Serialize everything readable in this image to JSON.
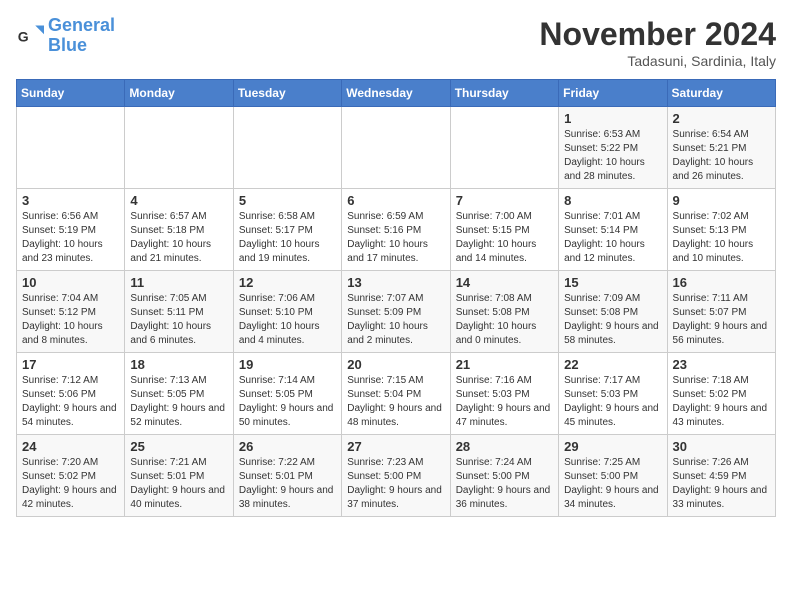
{
  "logo": {
    "line1": "General",
    "line2": "Blue"
  },
  "title": "November 2024",
  "location": "Tadasuni, Sardinia, Italy",
  "weekdays": [
    "Sunday",
    "Monday",
    "Tuesday",
    "Wednesday",
    "Thursday",
    "Friday",
    "Saturday"
  ],
  "weeks": [
    [
      {
        "day": "",
        "info": ""
      },
      {
        "day": "",
        "info": ""
      },
      {
        "day": "",
        "info": ""
      },
      {
        "day": "",
        "info": ""
      },
      {
        "day": "",
        "info": ""
      },
      {
        "day": "1",
        "info": "Sunrise: 6:53 AM\nSunset: 5:22 PM\nDaylight: 10 hours\nand 28 minutes."
      },
      {
        "day": "2",
        "info": "Sunrise: 6:54 AM\nSunset: 5:21 PM\nDaylight: 10 hours\nand 26 minutes."
      }
    ],
    [
      {
        "day": "3",
        "info": "Sunrise: 6:56 AM\nSunset: 5:19 PM\nDaylight: 10 hours\nand 23 minutes."
      },
      {
        "day": "4",
        "info": "Sunrise: 6:57 AM\nSunset: 5:18 PM\nDaylight: 10 hours\nand 21 minutes."
      },
      {
        "day": "5",
        "info": "Sunrise: 6:58 AM\nSunset: 5:17 PM\nDaylight: 10 hours\nand 19 minutes."
      },
      {
        "day": "6",
        "info": "Sunrise: 6:59 AM\nSunset: 5:16 PM\nDaylight: 10 hours\nand 17 minutes."
      },
      {
        "day": "7",
        "info": "Sunrise: 7:00 AM\nSunset: 5:15 PM\nDaylight: 10 hours\nand 14 minutes."
      },
      {
        "day": "8",
        "info": "Sunrise: 7:01 AM\nSunset: 5:14 PM\nDaylight: 10 hours\nand 12 minutes."
      },
      {
        "day": "9",
        "info": "Sunrise: 7:02 AM\nSunset: 5:13 PM\nDaylight: 10 hours\nand 10 minutes."
      }
    ],
    [
      {
        "day": "10",
        "info": "Sunrise: 7:04 AM\nSunset: 5:12 PM\nDaylight: 10 hours\nand 8 minutes."
      },
      {
        "day": "11",
        "info": "Sunrise: 7:05 AM\nSunset: 5:11 PM\nDaylight: 10 hours\nand 6 minutes."
      },
      {
        "day": "12",
        "info": "Sunrise: 7:06 AM\nSunset: 5:10 PM\nDaylight: 10 hours\nand 4 minutes."
      },
      {
        "day": "13",
        "info": "Sunrise: 7:07 AM\nSunset: 5:09 PM\nDaylight: 10 hours\nand 2 minutes."
      },
      {
        "day": "14",
        "info": "Sunrise: 7:08 AM\nSunset: 5:08 PM\nDaylight: 10 hours\nand 0 minutes."
      },
      {
        "day": "15",
        "info": "Sunrise: 7:09 AM\nSunset: 5:08 PM\nDaylight: 9 hours\nand 58 minutes."
      },
      {
        "day": "16",
        "info": "Sunrise: 7:11 AM\nSunset: 5:07 PM\nDaylight: 9 hours\nand 56 minutes."
      }
    ],
    [
      {
        "day": "17",
        "info": "Sunrise: 7:12 AM\nSunset: 5:06 PM\nDaylight: 9 hours\nand 54 minutes."
      },
      {
        "day": "18",
        "info": "Sunrise: 7:13 AM\nSunset: 5:05 PM\nDaylight: 9 hours\nand 52 minutes."
      },
      {
        "day": "19",
        "info": "Sunrise: 7:14 AM\nSunset: 5:05 PM\nDaylight: 9 hours\nand 50 minutes."
      },
      {
        "day": "20",
        "info": "Sunrise: 7:15 AM\nSunset: 5:04 PM\nDaylight: 9 hours\nand 48 minutes."
      },
      {
        "day": "21",
        "info": "Sunrise: 7:16 AM\nSunset: 5:03 PM\nDaylight: 9 hours\nand 47 minutes."
      },
      {
        "day": "22",
        "info": "Sunrise: 7:17 AM\nSunset: 5:03 PM\nDaylight: 9 hours\nand 45 minutes."
      },
      {
        "day": "23",
        "info": "Sunrise: 7:18 AM\nSunset: 5:02 PM\nDaylight: 9 hours\nand 43 minutes."
      }
    ],
    [
      {
        "day": "24",
        "info": "Sunrise: 7:20 AM\nSunset: 5:02 PM\nDaylight: 9 hours\nand 42 minutes."
      },
      {
        "day": "25",
        "info": "Sunrise: 7:21 AM\nSunset: 5:01 PM\nDaylight: 9 hours\nand 40 minutes."
      },
      {
        "day": "26",
        "info": "Sunrise: 7:22 AM\nSunset: 5:01 PM\nDaylight: 9 hours\nand 38 minutes."
      },
      {
        "day": "27",
        "info": "Sunrise: 7:23 AM\nSunset: 5:00 PM\nDaylight: 9 hours\nand 37 minutes."
      },
      {
        "day": "28",
        "info": "Sunrise: 7:24 AM\nSunset: 5:00 PM\nDaylight: 9 hours\nand 36 minutes."
      },
      {
        "day": "29",
        "info": "Sunrise: 7:25 AM\nSunset: 5:00 PM\nDaylight: 9 hours\nand 34 minutes."
      },
      {
        "day": "30",
        "info": "Sunrise: 7:26 AM\nSunset: 4:59 PM\nDaylight: 9 hours\nand 33 minutes."
      }
    ]
  ]
}
